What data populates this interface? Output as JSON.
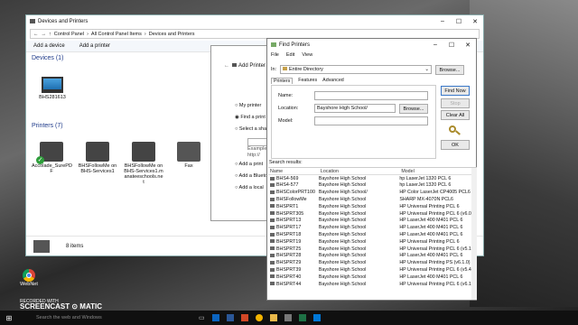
{
  "devices_window": {
    "title": "Devices and Printers",
    "breadcrumb": [
      "Control Panel",
      "All Control Panel Items",
      "Devices and Printers"
    ],
    "commands": [
      "Add a device",
      "Add a printer"
    ],
    "devices_header": "Devices (1)",
    "printers_header": "Printers (7)",
    "devices": [
      {
        "label": "BHS281613"
      }
    ],
    "printers": [
      {
        "label": "Accolade_SurePD\nF"
      },
      {
        "label": "BHSFollowMe on\nBHS-Services1"
      },
      {
        "label": "BHSFollowMe on\nBHS-Services1.m\nanateeschools.ne\nt"
      },
      {
        "label": "Fax"
      }
    ],
    "status": "8 items"
  },
  "add_printer_window": {
    "title": "Add Printer",
    "options": [
      "My printer",
      "Find a print",
      "Select a sha",
      "Add a print",
      "Add a Blueto",
      "Add a local"
    ],
    "example": "Example",
    "example2": "http://"
  },
  "find_window": {
    "title": "Find Printers",
    "menu": [
      "File",
      "Edit",
      "View"
    ],
    "in_label": "In:",
    "in_value": "Entire Directory",
    "browse1": "Browse...",
    "tabs": [
      "Printers",
      "Features",
      "Advanced"
    ],
    "name_label": "Name:",
    "location_label": "Location:",
    "location_value": "Bayshore High School/",
    "browse2": "Browse...",
    "model_label": "Model:",
    "find_now": "Find Now",
    "stop": "Stop",
    "clear_all": "Clear All",
    "ok": "OK",
    "search_results": "Search results:",
    "columns": [
      "Name",
      "Location",
      "Model"
    ],
    "rows": [
      [
        "BHS4-569",
        "Bayshore High School",
        "hp LaserJet 1320 PCL 6"
      ],
      [
        "BHS4-577",
        "Bayshore High School",
        "hp LaserJet 1320 PCL 6"
      ],
      [
        "BHSColorPRT100",
        "Bayshore High School/",
        "HP Color LaserJet CP4005 PCL6"
      ],
      [
        "BHSFollowMe",
        "Bayshore High School",
        "SHARP MX-4070N PCL6"
      ],
      [
        "BHSPRT1",
        "Bayshore High School",
        "HP Universal Printing PCL 6"
      ],
      [
        "BHSPRT305",
        "Bayshore High School",
        "HP Universal Printing PCL 6 (v6.0)"
      ],
      [
        "BHSPRT13",
        "Bayshore High School",
        "HP LaserJet 400 M401 PCL 6"
      ],
      [
        "BHSPRT17",
        "Bayshore High School",
        "HP LaserJet 400 M401 PCL 6"
      ],
      [
        "BHSPRT18",
        "Bayshore High School",
        "HP LaserJet 400 M401 PCL 6"
      ],
      [
        "BHSPRT19",
        "Bayshore High School",
        "HP Universal Printing PCL 6"
      ],
      [
        "BHSPRT25",
        "Bayshore High School",
        "HP Universal Printing PCL 6 (v5.1.0)"
      ],
      [
        "BHSPRT28",
        "Bayshore High School",
        "HP LaserJet 400 M401 PCL 6"
      ],
      [
        "BHSPRT29",
        "Bayshore High School",
        "HP Universal Printing PS (v6.1.0)"
      ],
      [
        "BHSPRT39",
        "Bayshore High School",
        "HP Universal Printing PCL 6 (v5.4)"
      ],
      [
        "BHSPRT40",
        "Bayshore High School",
        "HP LaserJet 400 M401 PCL 6"
      ],
      [
        "BHSPRT44",
        "Bayshore High School",
        "HP Universal Printing PCL 6 (v6.1)"
      ]
    ]
  },
  "desktop": {
    "icon_label": "WebNet",
    "search_placeholder": "Search the web and Windows"
  },
  "watermark": {
    "line1": "RECORDED WITH",
    "line2": "SCREENCAST",
    "line3": "MATIC"
  }
}
